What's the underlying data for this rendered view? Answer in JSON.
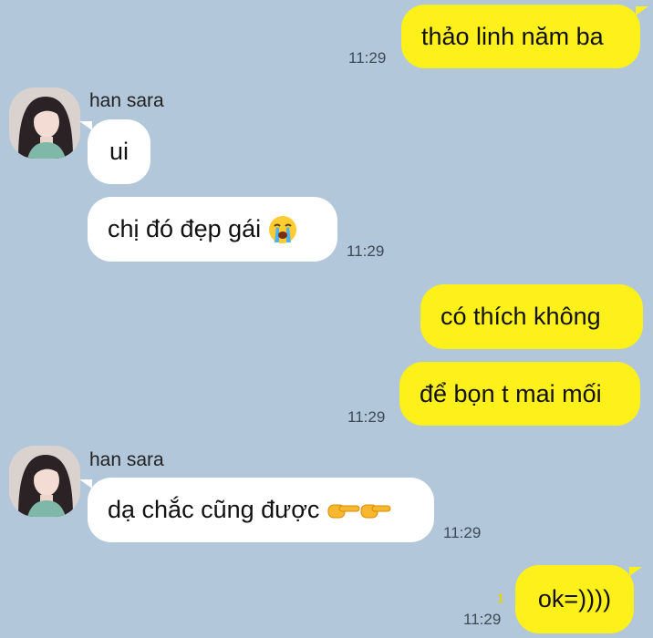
{
  "chat": {
    "messages": [
      {
        "text": "thảo linh năm ba",
        "time": "11:29"
      },
      {
        "sender": "han sara",
        "text": "ui"
      },
      {
        "text": "chị đó đẹp gái",
        "emoji": "loudly-crying-face",
        "time": "11:29"
      },
      {
        "text": "có thích không"
      },
      {
        "text": "để bọn t mai mối",
        "time": "11:29"
      },
      {
        "sender": "han sara",
        "text": "dạ chắc cũng được",
        "emoji": "backhand-index-pointing-right",
        "time": "11:29"
      },
      {
        "text": "ok=))))",
        "unread": "1",
        "time": "11:29"
      }
    ]
  },
  "colors": {
    "background": "#b2c7d9",
    "outgoing_bubble": "#fef01b",
    "incoming_bubble": "#ffffff"
  }
}
